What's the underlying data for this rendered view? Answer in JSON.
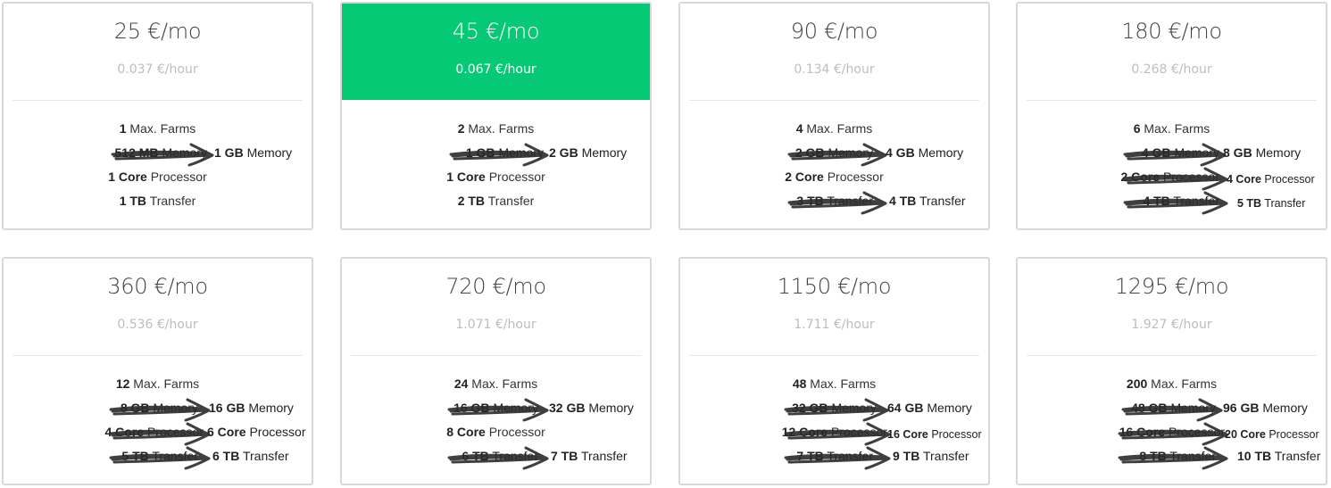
{
  "accent_color": "#06c975",
  "plans": [
    {
      "price": "25 €/mo",
      "hourly": "0.037 €/hour",
      "featured": false,
      "features": [
        {
          "type": "plain",
          "value": "1",
          "label": "Max. Farms"
        },
        {
          "type": "upgrade",
          "old_value": "512 MB",
          "old_label": "Memory",
          "new_value": "1 GB",
          "new_label": "Memory"
        },
        {
          "type": "plain",
          "value": "1 Core",
          "label": "Processor"
        },
        {
          "type": "plain",
          "value": "1 TB",
          "label": "Transfer"
        }
      ]
    },
    {
      "price": "45 €/mo",
      "hourly": "0.067 €/hour",
      "featured": true,
      "features": [
        {
          "type": "plain",
          "value": "2",
          "label": "Max. Farms"
        },
        {
          "type": "upgrade",
          "old_value": "1 GB",
          "old_label": "Memory",
          "new_value": "2 GB",
          "new_label": "Memory"
        },
        {
          "type": "plain",
          "value": "1 Core",
          "label": "Processor"
        },
        {
          "type": "plain",
          "value": "2 TB",
          "label": "Transfer"
        }
      ]
    },
    {
      "price": "90 €/mo",
      "hourly": "0.134 €/hour",
      "featured": false,
      "features": [
        {
          "type": "plain",
          "value": "4",
          "label": "Max. Farms"
        },
        {
          "type": "upgrade",
          "old_value": "2 GB",
          "old_label": "Memory",
          "new_value": "4 GB",
          "new_label": "Memory"
        },
        {
          "type": "plain",
          "value": "2 Core",
          "label": "Processor"
        },
        {
          "type": "upgrade",
          "old_value": "3 TB",
          "old_label": "Transfer",
          "new_value": "4 TB",
          "new_label": "Transfer"
        }
      ]
    },
    {
      "price": "180 €/mo",
      "hourly": "0.268 €/hour",
      "featured": false,
      "features": [
        {
          "type": "plain",
          "value": "6",
          "label": "Max. Farms"
        },
        {
          "type": "upgrade",
          "old_value": "4 GB",
          "old_label": "Memory",
          "new_value": "8 GB",
          "new_label": "Memory"
        },
        {
          "type": "upgrade",
          "old_value": "2 Core",
          "old_label": "Processor",
          "new_value": "4 Core",
          "new_label": "Processor",
          "small": true
        },
        {
          "type": "upgrade",
          "old_value": "4 TB",
          "old_label": "Transfer",
          "new_value": "5 TB",
          "new_label": "Transfer",
          "small": true
        }
      ]
    },
    {
      "price": "360 €/mo",
      "hourly": "0.536 €/hour",
      "featured": false,
      "features": [
        {
          "type": "plain",
          "value": "12",
          "label": "Max. Farms"
        },
        {
          "type": "upgrade",
          "old_value": "8 GB",
          "old_label": "Memory",
          "new_value": "16 GB",
          "new_label": "Memory"
        },
        {
          "type": "upgrade",
          "old_value": "4 Core",
          "old_label": "Processor",
          "new_value": "6 Core",
          "new_label": "Processor"
        },
        {
          "type": "upgrade",
          "old_value": "5 TB",
          "old_label": "Transfer",
          "new_value": "6 TB",
          "new_label": "Transfer"
        }
      ]
    },
    {
      "price": "720 €/mo",
      "hourly": "1.071 €/hour",
      "featured": false,
      "features": [
        {
          "type": "plain",
          "value": "24",
          "label": "Max. Farms"
        },
        {
          "type": "upgrade",
          "old_value": "16 GB",
          "old_label": "Memory",
          "new_value": "32 GB",
          "new_label": "Memory"
        },
        {
          "type": "plain",
          "value": "8 Core",
          "label": "Processor"
        },
        {
          "type": "upgrade",
          "old_value": "6 TB",
          "old_label": "Transfer",
          "new_value": "7 TB",
          "new_label": "Transfer"
        }
      ]
    },
    {
      "price": "1150 €/mo",
      "hourly": "1.711 €/hour",
      "featured": false,
      "features": [
        {
          "type": "plain",
          "value": "48",
          "label": "Max. Farms"
        },
        {
          "type": "upgrade",
          "old_value": "32 GB",
          "old_label": "Memory",
          "new_value": "64 GB",
          "new_label": "Memory"
        },
        {
          "type": "upgrade",
          "old_value": "12 Core",
          "old_label": "Processor",
          "new_value": "16 Core",
          "new_label": "Processor",
          "small": true
        },
        {
          "type": "upgrade",
          "old_value": "7 TB",
          "old_label": "Transfer",
          "new_value": "9 TB",
          "new_label": "Transfer"
        }
      ]
    },
    {
      "price": "1295 €/mo",
      "hourly": "1.927 €/hour",
      "featured": false,
      "features": [
        {
          "type": "plain",
          "value": "200",
          "label": "Max. Farms"
        },
        {
          "type": "upgrade",
          "old_value": "48 GB",
          "old_label": "Memory",
          "new_value": "96 GB",
          "new_label": "Memory"
        },
        {
          "type": "upgrade",
          "old_value": "16 Core",
          "old_label": "Processor",
          "new_value": "20 Core",
          "new_label": "Processor",
          "small": true
        },
        {
          "type": "upgrade",
          "old_value": "8 TB",
          "old_label": "Transfer",
          "new_value": "10 TB",
          "new_label": "Transfer"
        }
      ]
    }
  ]
}
